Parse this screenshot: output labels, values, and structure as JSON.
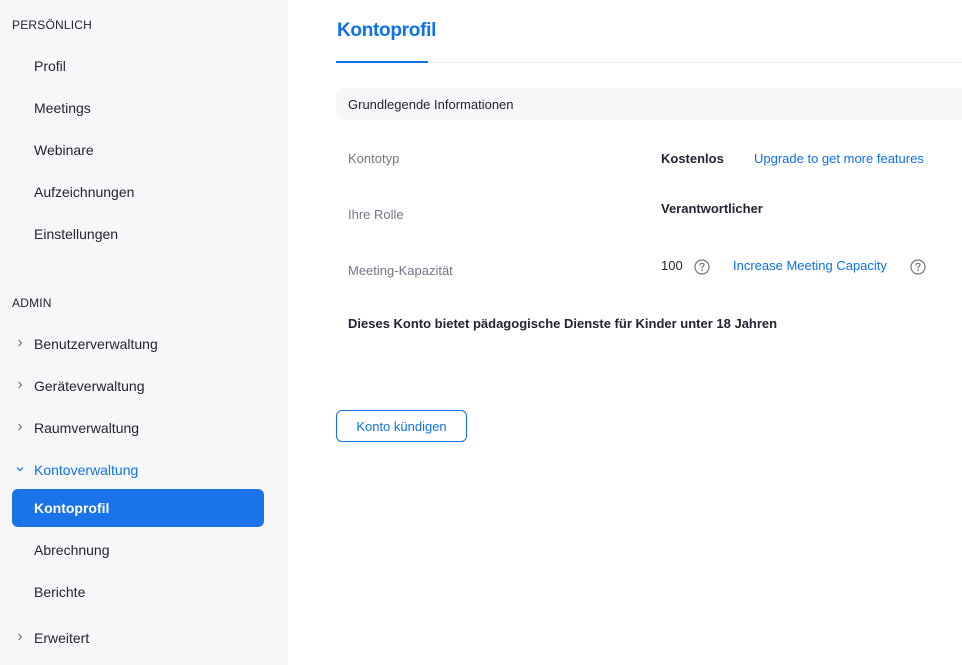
{
  "sidebar": {
    "personal_title": "PERSÖNLICH",
    "personal_items": [
      {
        "label": "Profil"
      },
      {
        "label": "Meetings"
      },
      {
        "label": "Webinare"
      },
      {
        "label": "Aufzeichnungen"
      },
      {
        "label": "Einstellungen"
      }
    ],
    "admin_title": "ADMIN",
    "admin_items": [
      {
        "label": "Benutzerverwaltung",
        "icon": "chevron-right-icon"
      },
      {
        "label": "Geräteverwaltung",
        "icon": "chevron-right-icon"
      },
      {
        "label": "Raumverwaltung",
        "icon": "chevron-right-icon"
      },
      {
        "label": "Kontoverwaltung",
        "icon": "chevron-down-icon",
        "expanded": true
      },
      {
        "label": "Kontoprofil",
        "active": true
      },
      {
        "label": "Abrechnung"
      },
      {
        "label": "Berichte"
      },
      {
        "label": "Erweitert",
        "icon": "chevron-right-icon"
      }
    ]
  },
  "main": {
    "tab_title": "Kontoprofil",
    "section_header": "Grundlegende Informationen",
    "rows": {
      "account_type": {
        "label": "Kontotyp",
        "value": "Kostenlos",
        "link": "Upgrade to get more features"
      },
      "role": {
        "label": "Ihre Rolle",
        "value": "Verantwortlicher"
      },
      "capacity": {
        "label": "Meeting-Kapazität",
        "value": "100",
        "link": "Increase Meeting Capacity",
        "icon": "help-circle-icon"
      }
    },
    "notice": "Dieses Konto bietet pädagogische Dienste für Kinder unter 18 Jahren",
    "cancel_button": "Konto kündigen"
  },
  "colors": {
    "accent": "#0e71eb",
    "active_bg": "#1a73e8",
    "sidebar_bg": "#f6f7f9",
    "label_gray": "#747487"
  }
}
